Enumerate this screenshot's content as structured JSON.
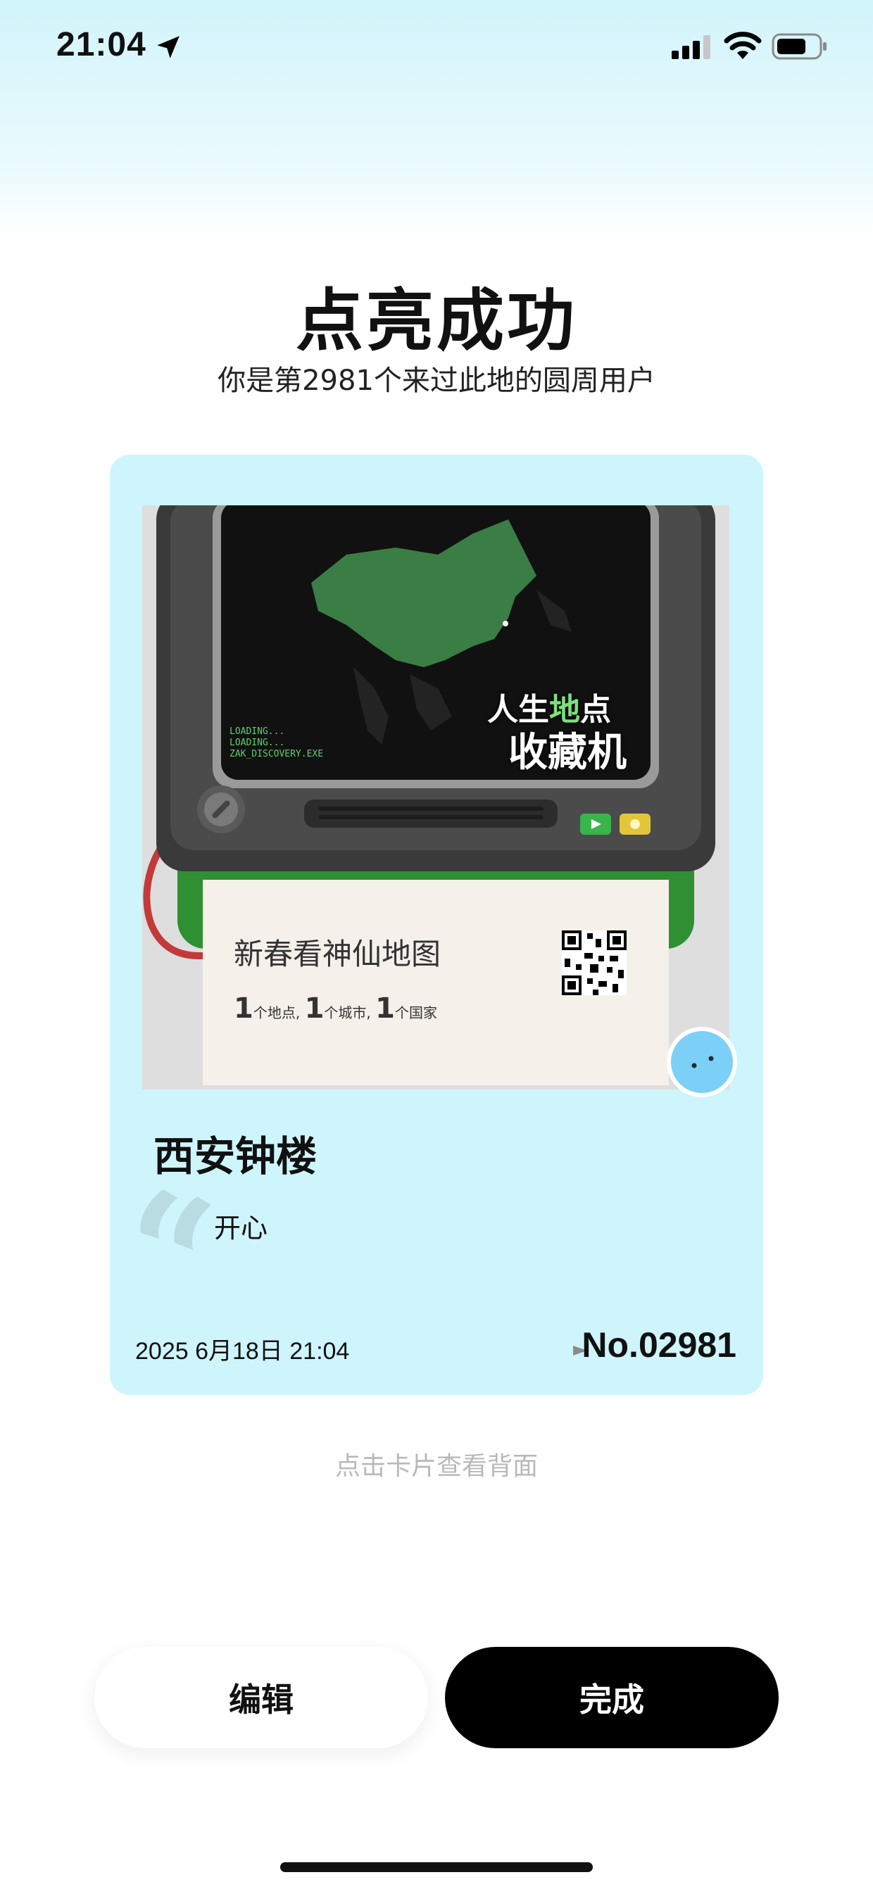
{
  "status_bar": {
    "time": "21:04",
    "icons": [
      "location-arrow-icon",
      "cellular-signal-icon",
      "wifi-icon",
      "battery-icon"
    ]
  },
  "header": {
    "title": "点亮成功",
    "subtitle": "你是第2981个来过此地的圆周用户"
  },
  "card": {
    "poster": {
      "screen_lines": [
        "LOADING...",
        "LOADING...",
        "ZAK_DISCOVERY.EXE"
      ],
      "slogan_line1_a": "人生",
      "slogan_line1_b": "地",
      "slogan_line1_c": "点",
      "slogan_line2": "收藏机",
      "ticket_title": "新春看神仙地图",
      "stats": {
        "places_num": "1",
        "places_label": "个地点,",
        "cities_num": "1",
        "cities_label": "个城市,",
        "countries_num": "1",
        "countries_label": "个国家"
      }
    },
    "place_name": "西安钟楼",
    "mood": "开心",
    "date": "2025   6月18日  21:04",
    "number": "No.02981",
    "colors": {
      "card_bg": "#cff5fc",
      "map_green": "#3a7d45",
      "accent_green": "#39b54a"
    }
  },
  "hint": "点击卡片查看背面",
  "buttons": {
    "edit": "编辑",
    "done": "完成"
  }
}
